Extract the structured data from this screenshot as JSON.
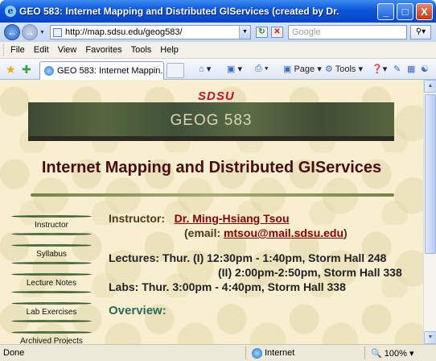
{
  "window": {
    "title": "GEO 583:  Internet Mapping and Distributed GIServices (created by Dr. Ming-H...",
    "controls": [
      "_",
      "□",
      "X"
    ]
  },
  "address_bar": {
    "url": "http://map.sdsu.edu/geog583/",
    "search_placeholder": "Google"
  },
  "menu": [
    "File",
    "Edit",
    "View",
    "Favorites",
    "Tools",
    "Help"
  ],
  "tabbar": {
    "tab_title": "GEO 583:  Internet Mappin...",
    "commands": {
      "page": "Page",
      "tools": "Tools"
    }
  },
  "page": {
    "logo": "SDSU",
    "banner": "GEOG 583",
    "heading": "Internet Mapping and Distributed GIServices",
    "nav": [
      "Instructor",
      "Syllabus",
      "Lecture Notes",
      "Lab Exercises",
      "Archived Projects"
    ],
    "instructor_label": "Instructor:",
    "instructor_name": "Dr. Ming-Hsiang Tsou",
    "email_prefix": "(email: ",
    "email": "mtsou@mail.sdsu.edu",
    "email_suffix": ")",
    "lectures_1": "Lectures: Thur. (I) 12:30pm - 1:40pm, Storm Hall 248",
    "lectures_2": "(II) 2:00pm-2:50pm, Storm Hall 338",
    "labs": "Labs: Thur. 3:00pm - 4:40pm,  Storm Hall 338",
    "overview": "Overview:"
  },
  "status": {
    "text": "Done",
    "zone": "Internet",
    "zoom": "100%"
  }
}
